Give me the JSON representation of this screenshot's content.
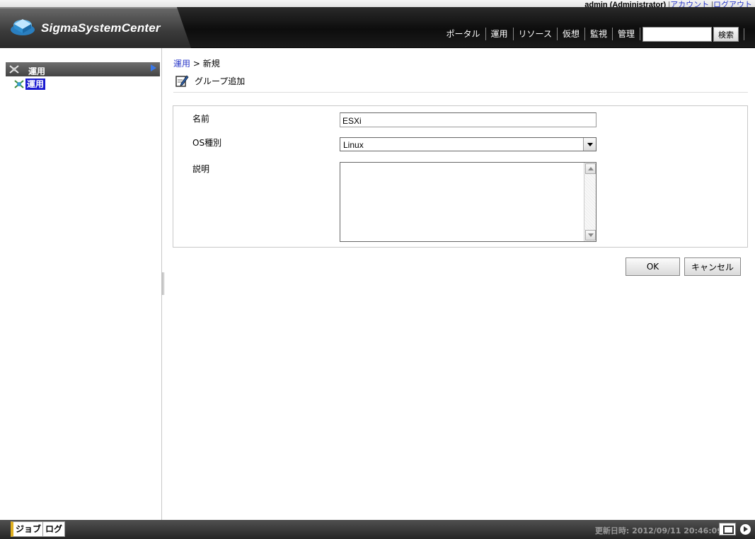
{
  "user": {
    "name": "admin (Administrator)",
    "separator": "|",
    "account_link": "アカウント",
    "logout_link": "ログアウト"
  },
  "logo": {
    "text": "SigmaSystemCenter"
  },
  "nav": {
    "items": [
      "ポータル",
      "運用",
      "リソース",
      "仮想",
      "監視",
      "管理"
    ]
  },
  "search": {
    "value": "",
    "button": "検索"
  },
  "sidebar": {
    "header": "運用",
    "item": "運用"
  },
  "breadcrumb": {
    "link": "運用",
    "sep": " > ",
    "current": "新規"
  },
  "page": {
    "title": "グループ追加"
  },
  "form": {
    "name_label": "名前",
    "name_value": "ESXi",
    "os_label": "OS種別",
    "os_value": "Linux",
    "desc_label": "説明",
    "desc_value": ""
  },
  "buttons": {
    "ok": "OK",
    "cancel": "キャンセル"
  },
  "footer": {
    "tab_job": "ジョブ",
    "tab_log": "ログ",
    "update_label": "更新日時:",
    "update_time": "2012/09/11 20:46:09"
  },
  "colors": {
    "accent_blue": "#1a1ad0",
    "link": "#2a38c8",
    "header_dark": "#0d0d0d"
  }
}
